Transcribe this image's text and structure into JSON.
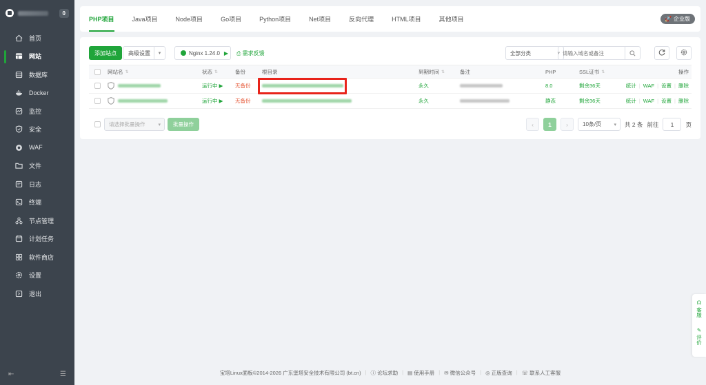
{
  "sidebar": {
    "badge": "0",
    "items": [
      {
        "label": "首页",
        "icon": "home-icon"
      },
      {
        "label": "网站",
        "icon": "website-icon",
        "active": true
      },
      {
        "label": "数据库",
        "icon": "database-icon"
      },
      {
        "label": "Docker",
        "icon": "docker-icon"
      },
      {
        "label": "监控",
        "icon": "monitor-icon"
      },
      {
        "label": "安全",
        "icon": "shield-icon"
      },
      {
        "label": "WAF",
        "icon": "waf-icon"
      },
      {
        "label": "文件",
        "icon": "folder-icon"
      },
      {
        "label": "日志",
        "icon": "log-icon"
      },
      {
        "label": "终端",
        "icon": "terminal-icon"
      },
      {
        "label": "节点管理",
        "icon": "node-icon"
      },
      {
        "label": "计划任务",
        "icon": "calendar-icon"
      },
      {
        "label": "软件商店",
        "icon": "store-icon"
      },
      {
        "label": "设置",
        "icon": "gear-icon"
      },
      {
        "label": "退出",
        "icon": "logout-icon"
      }
    ]
  },
  "tabs": [
    {
      "label": "PHP项目",
      "active": true
    },
    {
      "label": "Java项目"
    },
    {
      "label": "Node项目"
    },
    {
      "label": "Go项目"
    },
    {
      "label": "Python项目"
    },
    {
      "label": "Net项目"
    },
    {
      "label": "反向代理"
    },
    {
      "label": "HTML项目"
    },
    {
      "label": "其他项目"
    }
  ],
  "edition_badge": "企业版",
  "toolbar": {
    "add_site": "添加站点",
    "advanced": "高级设置",
    "nginx": "Nginx 1.24.0",
    "feedback": "需求反馈",
    "category": "全部分类",
    "search_placeholder": "请输入域名或备注"
  },
  "table": {
    "headers": {
      "name": "网站名",
      "status": "状态",
      "backup": "备份",
      "root": "根目录",
      "expire": "到期时间",
      "remark": "备注",
      "php": "PHP",
      "ssl": "SSL证书",
      "ops": "操作"
    },
    "rows": [
      {
        "status": "运行中",
        "backup": "无备份",
        "expire": "永久",
        "php": "8.0",
        "ssl": "剩余36天"
      },
      {
        "status": "运行中",
        "backup": "无备份",
        "expire": "永久",
        "php": "静态",
        "ssl": "剩余36天"
      }
    ],
    "ops": {
      "stats": "统计",
      "waf": "WAF",
      "settings": "设置",
      "delete": "删除"
    }
  },
  "footer_bar": {
    "batch_placeholder": "请选择批量操作",
    "batch_button": "批量操作",
    "current_page": "1",
    "per_page": "10条/页",
    "total": "共 2 条",
    "goto": "前往",
    "goto_value": "1",
    "page_unit": "页"
  },
  "float": {
    "service": "客服",
    "review": "评价"
  },
  "page_footer": {
    "copyright": "宝塔Linux面板©2014-2026 广东堡塔安全技术有限公司 (bt.cn)",
    "links": [
      "论坛求助",
      "使用手册",
      "微信公众号",
      "正版查询",
      "联系人工客服"
    ]
  },
  "colors": {
    "accent": "#20a53a",
    "sidebar_bg": "#3c444d",
    "highlight": "#e8231a",
    "danger": "#e65c3c"
  }
}
